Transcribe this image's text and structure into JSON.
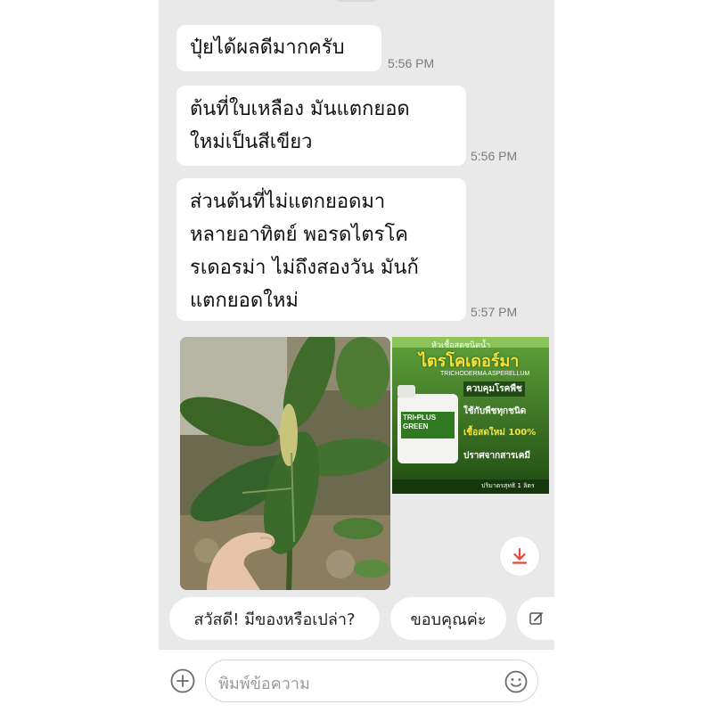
{
  "messages": [
    {
      "text": "ปุ๋ยได้ผลดีมากครับ",
      "time": "5:56 PM"
    },
    {
      "lines": [
        "ต้นที่ใบเหลือง มันแตกยอด",
        "ใหม่เป็นสีเขียว"
      ],
      "time": "5:56 PM"
    },
    {
      "lines": [
        "ส่วนต้นที่ไม่แตกยอดมา",
        "หลายอาทิตย์ พอรดไตรโค",
        "รเดอรม่า ไม่ถึงสองวัน มันก้",
        "แตกยอดใหม่"
      ],
      "time": "5:57 PM"
    }
  ],
  "ad": {
    "top_line": "หัวเชื้อสดชนิดน้ำ",
    "title": "ไตรโคเดอร์มา",
    "subtitle": "TRICHODERMA ASPERELLUM",
    "bottle_brand": "TRI•PLUS GREEN",
    "claims": [
      "ควบคุมโรคพืช",
      "ใช้กับพืชทุกชนิด",
      "เชื้อสดใหม่ 100%",
      "ปราศจากสารเคมี"
    ],
    "volume": "ปริมาตรสุทธิ 1 ลิตร"
  },
  "quick_replies": [
    "สวัสดี! มีของหรือเปล่า?",
    "ขอบคุณค่ะ"
  ],
  "input": {
    "placeholder": "พิมพ์ข้อความ"
  },
  "icons": {
    "download": "download-icon",
    "edit": "edit-icon",
    "add": "plus-circle-icon",
    "emoji": "emoji-icon"
  },
  "colors": {
    "background": "#e9e9ea",
    "bubble": "#ffffff",
    "accent": "#e8453c",
    "timestamp": "#7b7b7e"
  }
}
